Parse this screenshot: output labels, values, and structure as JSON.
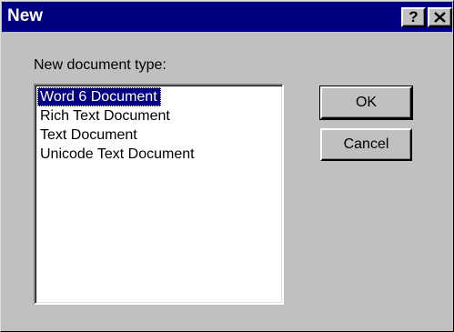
{
  "window": {
    "title": "New",
    "help_label": "?",
    "close_icon": "close-icon",
    "title_bg": "#000080",
    "face_color": "#c0c0c0"
  },
  "label": "New document type:",
  "list": {
    "items": [
      "Word 6 Document",
      "Rich Text Document",
      "Text Document",
      "Unicode Text Document"
    ],
    "selected": "Word 6 Document"
  },
  "buttons": {
    "ok": "OK",
    "cancel": "Cancel"
  }
}
